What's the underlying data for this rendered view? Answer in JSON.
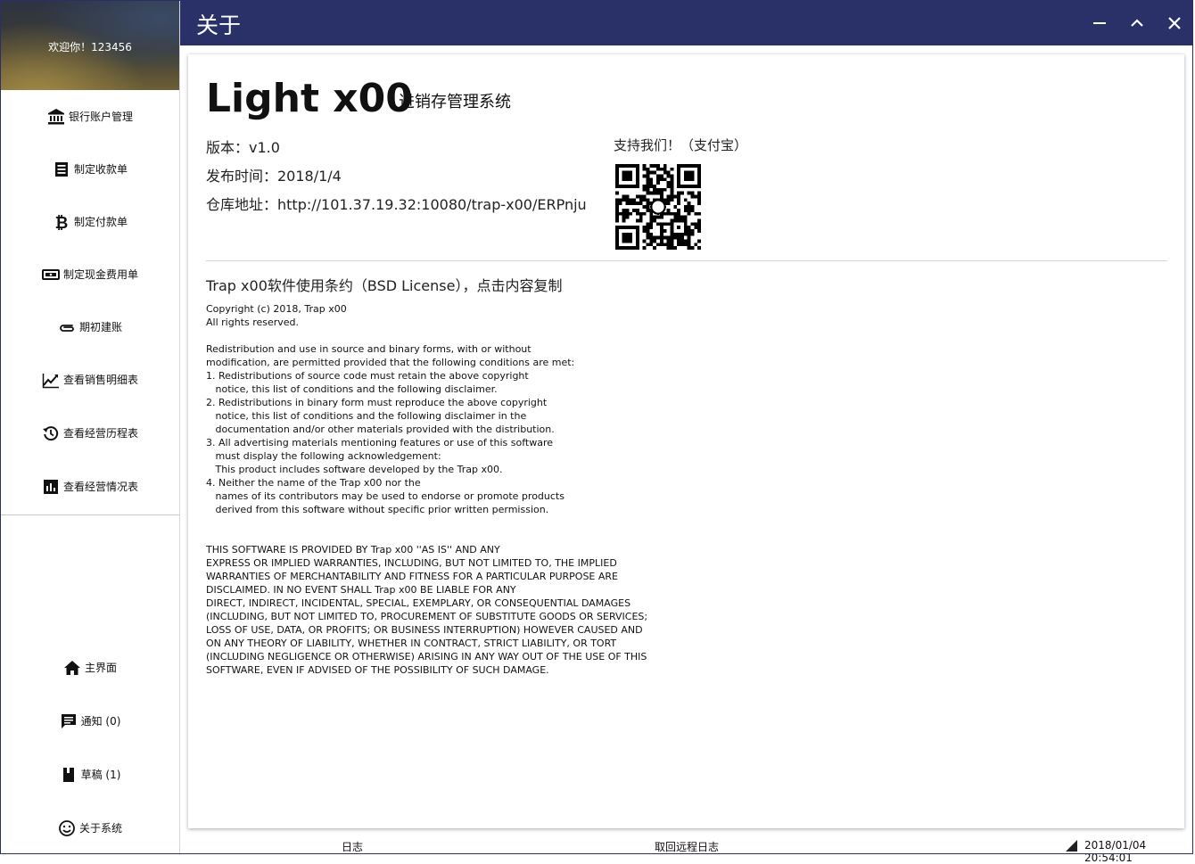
{
  "sidebar": {
    "welcome": "欢迎你！123456",
    "items": [
      {
        "label": "银行账户管理",
        "icon": "bank-icon"
      },
      {
        "label": "制定收款单",
        "icon": "receipt-icon"
      },
      {
        "label": "制定付款单",
        "icon": "bitcoin-icon"
      },
      {
        "label": "制定现金费用单",
        "icon": "cash-icon"
      },
      {
        "label": "期初建账",
        "icon": "paperclip-icon"
      },
      {
        "label": "查看销售明细表",
        "icon": "trending-up-icon"
      },
      {
        "label": "查看经营历程表",
        "icon": "history-icon"
      },
      {
        "label": "查看经营情况表",
        "icon": "bar-chart-icon"
      }
    ],
    "bottom_items": [
      {
        "label": "主界面",
        "icon": "home-icon"
      },
      {
        "label": "通知 (0)",
        "icon": "message-icon"
      },
      {
        "label": "草稿 (1)",
        "icon": "book-icon"
      },
      {
        "label": "关于系统",
        "icon": "smiley-icon"
      }
    ]
  },
  "titlebar": {
    "title": "关于",
    "buttons": [
      "minimize-icon",
      "maximize-icon",
      "close-icon"
    ]
  },
  "about": {
    "app_name": "Light x00",
    "app_subtitle": "进销存管理系统",
    "version": "版本：v1.0",
    "release": "发布时间：2018/1/4",
    "repo": "仓库地址：http://101.37.19.32:10080/trap-x00/ERPnju",
    "support": "支持我们！（支付宝）",
    "license_title": "Trap x00软件使用条约（BSD License），点击内容复制",
    "license_text": "Copyright (c) 2018, Trap x00\nAll rights reserved.\n\nRedistribution and use in source and binary forms, with or without\nmodification, are permitted provided that the following conditions are met:\n1. Redistributions of source code must retain the above copyright\n   notice, this list of conditions and the following disclaimer.\n2. Redistributions in binary form must reproduce the above copyright\n   notice, this list of conditions and the following disclaimer in the\n   documentation and/or other materials provided with the distribution.\n3. All advertising materials mentioning features or use of this software\n   must display the following acknowledgement:\n   This product includes software developed by the Trap x00.\n4. Neither the name of the Trap x00 nor the\n   names of its contributors may be used to endorse or promote products\n   derived from this software without specific prior written permission.\n\n\nTHIS SOFTWARE IS PROVIDED BY Trap x00 ''AS IS'' AND ANY\nEXPRESS OR IMPLIED WARRANTIES, INCLUDING, BUT NOT LIMITED TO, THE IMPLIED\nWARRANTIES OF MERCHANTABILITY AND FITNESS FOR A PARTICULAR PURPOSE ARE\nDISCLAIMED. IN NO EVENT SHALL Trap x00 BE LIABLE FOR ANY\nDIRECT, INDIRECT, INCIDENTAL, SPECIAL, EXEMPLARY, OR CONSEQUENTIAL DAMAGES\n(INCLUDING, BUT NOT LIMITED TO, PROCUREMENT OF SUBSTITUTE GOODS OR SERVICES;\nLOSS OF USE, DATA, OR PROFITS; OR BUSINESS INTERRUPTION) HOWEVER CAUSED AND\nON ANY THEORY OF LIABILITY, WHETHER IN CONTRACT, STRICT LIABILITY, OR TORT\n(INCLUDING NEGLIGENCE OR OTHERWISE) ARISING IN ANY WAY OUT OF THE USE OF THIS\nSOFTWARE, EVEN IF ADVISED OF THE POSSIBILITY OF SUCH DAMAGE."
  },
  "statusbar": {
    "log": "日志",
    "remote_log": "取回远程日志",
    "datetime": "2018/01/04 20:54:01"
  },
  "colors": {
    "titlebar": "#293168",
    "sidebar_bg": "#ffffff",
    "text": "#111111"
  }
}
